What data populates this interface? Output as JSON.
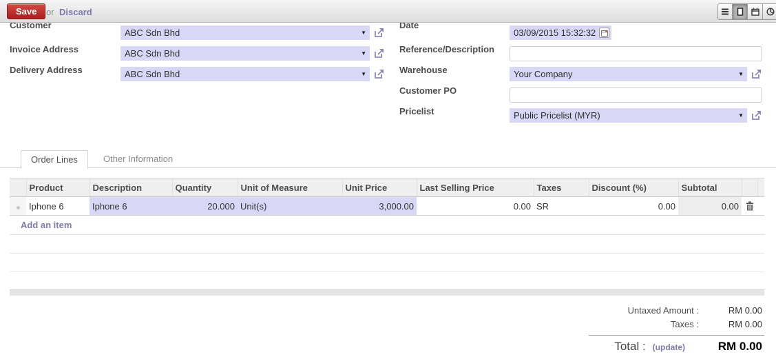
{
  "topbar": {
    "save": "Save",
    "or": "or",
    "discard": "Discard"
  },
  "view_switcher": {
    "buttons": [
      "list",
      "form",
      "calendar",
      "graph"
    ],
    "active": "form"
  },
  "fields": {
    "left": [
      {
        "label": "Customer",
        "value": "ABC Sdn Bhd"
      },
      {
        "label": "Invoice Address",
        "value": "ABC Sdn Bhd"
      },
      {
        "label": "Delivery Address",
        "value": "ABC Sdn Bhd"
      }
    ],
    "right": [
      {
        "label": "Date",
        "value": "03/09/2015 15:32:32"
      },
      {
        "label": "Reference/Description",
        "value": ""
      },
      {
        "label": "Warehouse",
        "value": "Your Company"
      },
      {
        "label": "Customer PO",
        "value": ""
      },
      {
        "label": "Pricelist",
        "value": "Public Pricelist (MYR)"
      }
    ]
  },
  "tabs": [
    {
      "label": "Order Lines",
      "active": true
    },
    {
      "label": "Other Information",
      "active": false
    }
  ],
  "order_lines": {
    "columns": [
      "Product",
      "Description",
      "Quantity",
      "Unit of Measure",
      "Unit Price",
      "Last Selling Price",
      "Taxes",
      "Discount (%)",
      "Subtotal"
    ],
    "rows": [
      {
        "product": "Iphone 6",
        "description": "Iphone 6",
        "quantity": "20.000",
        "uom": "Unit(s)",
        "unit_price": "3,000.00",
        "last_selling_price": "0.00",
        "taxes": "SR",
        "discount": "0.00",
        "subtotal": "0.00"
      }
    ],
    "add_item": "Add an item"
  },
  "totals": {
    "untaxed_label": "Untaxed Amount :",
    "untaxed_value": "RM 0.00",
    "taxes_label": "Taxes :",
    "taxes_value": "RM 0.00",
    "total_label": "Total :",
    "update_link": "(update)",
    "total_value": "RM 0.00"
  },
  "colors": {
    "accent": "#7c7bad",
    "field_bg": "#d8d8f6",
    "save_red": "#a81f1f"
  }
}
